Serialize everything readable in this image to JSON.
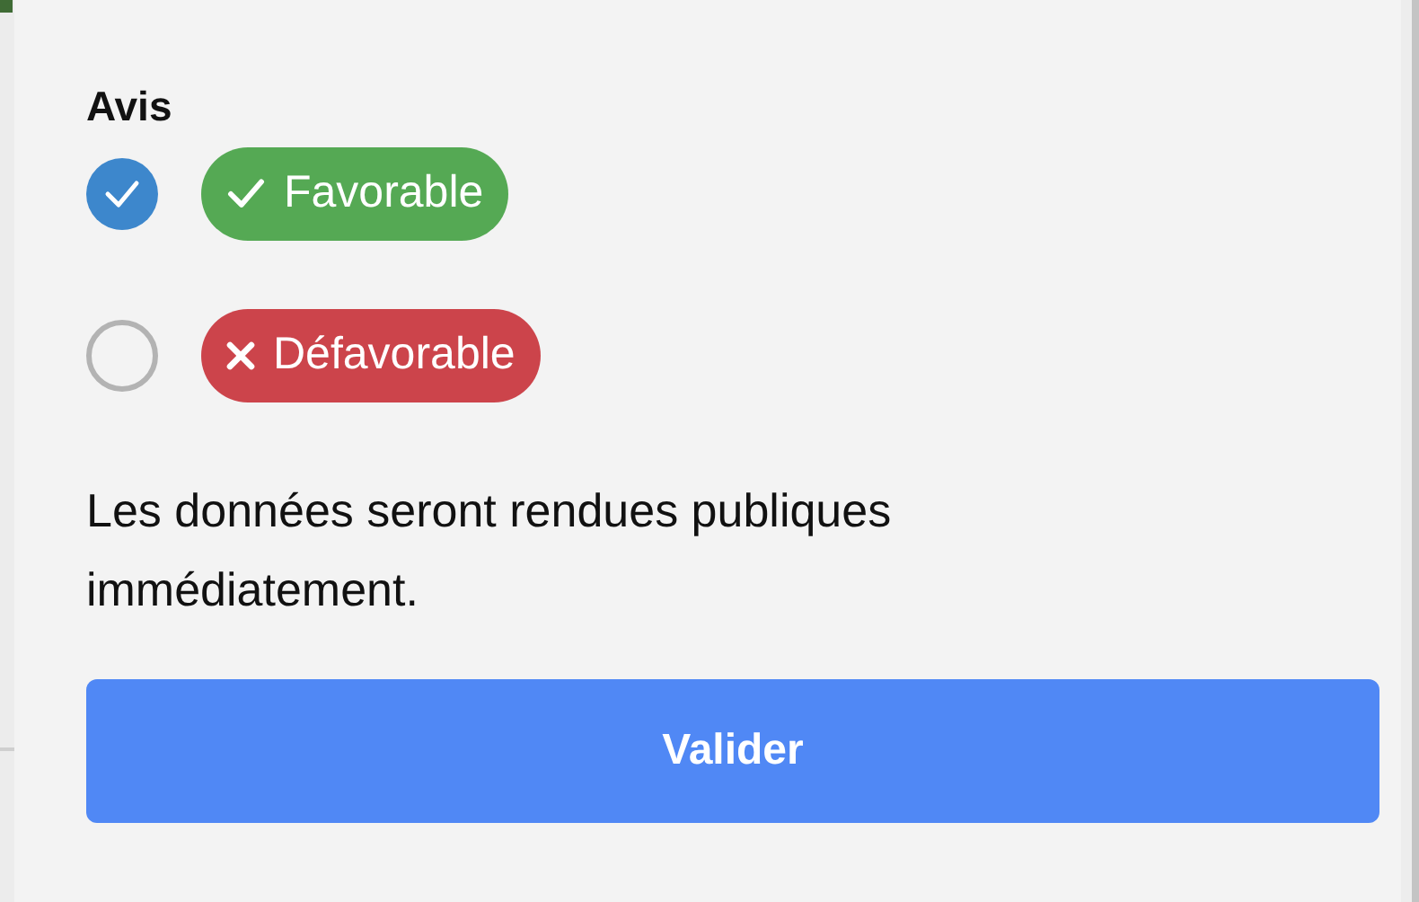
{
  "form": {
    "heading": "Avis",
    "options": [
      {
        "label": "Favorable",
        "kind": "check",
        "color": "#55a954",
        "selected": true
      },
      {
        "label": "Défavorable",
        "kind": "cross",
        "color": "#cc444b",
        "selected": false
      }
    ],
    "note": "Les données seront rendues publiques immédiatement.",
    "submit": "Valider"
  }
}
